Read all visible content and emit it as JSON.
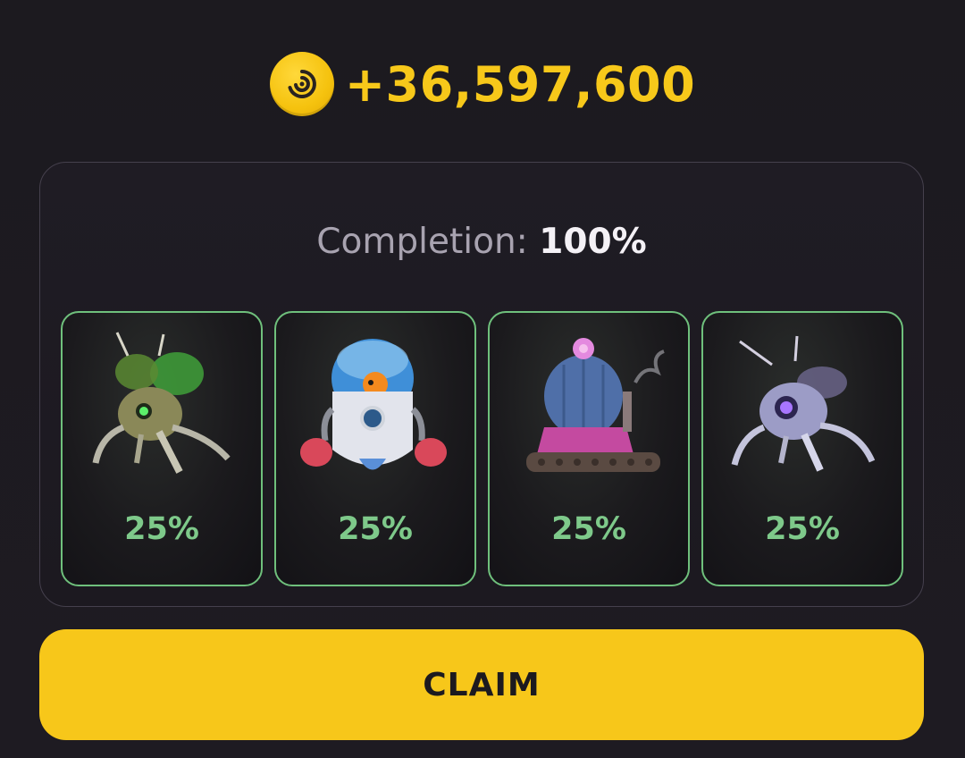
{
  "reward": {
    "icon": "coin-icon",
    "amount": "+36,597,600",
    "color": "#f7c81a"
  },
  "completion": {
    "label": "Completion:",
    "value": "100%"
  },
  "cards": [
    {
      "icon": "green-bug-robot-icon",
      "percent": "25%"
    },
    {
      "icon": "fish-bowl-boxer-robot-icon",
      "percent": "25%"
    },
    {
      "icon": "cactus-tank-robot-icon",
      "percent": "25%"
    },
    {
      "icon": "purple-bug-robot-icon",
      "percent": "25%"
    }
  ],
  "claim": {
    "label": "CLAIM",
    "color": "#f7c71a"
  },
  "colors": {
    "background": "#1d1a20",
    "card_border": "#6fc07c",
    "percent_text": "#7ec98a"
  }
}
